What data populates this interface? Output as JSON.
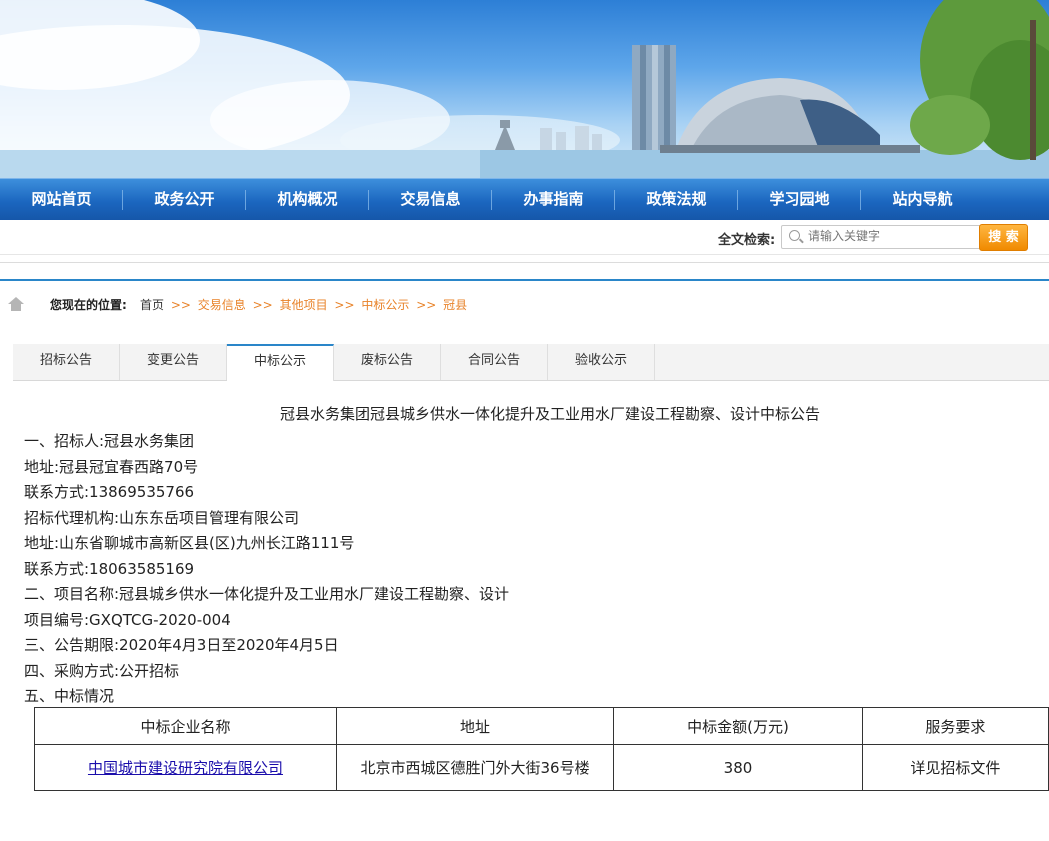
{
  "nav": {
    "items": [
      "网站首页",
      "政务公开",
      "机构概况",
      "交易信息",
      "办事指南",
      "政策法规",
      "学习园地",
      "站内导航"
    ]
  },
  "search": {
    "label": "全文检索:",
    "placeholder": "请输入关键字",
    "button": "搜 索"
  },
  "breadcrumb": {
    "label": "您现在的位置:",
    "items": [
      "首页",
      "交易信息",
      "其他项目",
      "中标公示",
      "冠县"
    ],
    "separator": ">>"
  },
  "tabs": {
    "items": [
      "招标公告",
      "变更公告",
      "中标公示",
      "废标公告",
      "合同公告",
      "验收公示"
    ],
    "active": "中标公示"
  },
  "article": {
    "title": "冠县水务集团冠县城乡供水一体化提升及工业用水厂建设工程勘察、设计中标公告",
    "lines": [
      "一、招标人:冠县水务集团",
      "地址:冠县冠宜春西路70号",
      "联系方式:13869535766",
      "招标代理机构:山东东岳项目管理有限公司",
      "地址:山东省聊城市高新区县(区)九州长江路111号",
      "联系方式:18063585169",
      "二、项目名称:冠县城乡供水一体化提升及工业用水厂建设工程勘察、设计",
      "项目编号:GXQTCG-2020-004",
      "三、公告期限:2020年4月3日至2020年4月5日",
      "四、采购方式:公开招标",
      "五、中标情况"
    ]
  },
  "result_table": {
    "headers": [
      "中标企业名称",
      "地址",
      "中标金额(万元)",
      "服务要求"
    ],
    "rows": [
      [
        "中国城市建设研究院有限公司",
        "北京市西城区德胜门外大街36号楼",
        "380",
        "详见招标文件"
      ]
    ]
  },
  "colors": {
    "nav_blue": "#1b66bf",
    "accent_blue": "#2a86c9",
    "breadcrumb_orange": "#e8832a",
    "search_button_orange": "#f08a00",
    "link_blue": "#1a0dab"
  }
}
